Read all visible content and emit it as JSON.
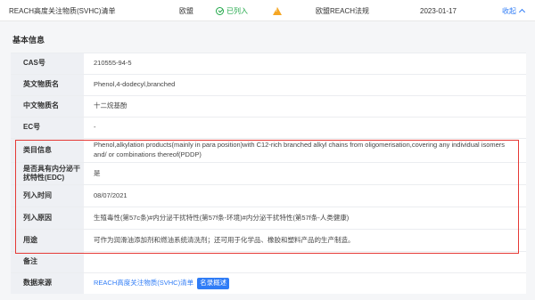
{
  "topbar": {
    "name": "REACH高度关注物质(SVHC)清单",
    "region": "欧盟",
    "status": "已列入",
    "law": "欧盟REACH法规",
    "date": "2023-01-17",
    "collapse_label": "收起"
  },
  "section_title": "基本信息",
  "rows": [
    {
      "label": "CAS号",
      "value": "210555-94-5"
    },
    {
      "label": "英文物质名",
      "value": "Phenol,4-dodecyl,branched"
    },
    {
      "label": "中文物质名",
      "value": "十二烷基酚"
    },
    {
      "label": "EC号",
      "value": "-"
    },
    {
      "label": "类目信息",
      "value": "Phenol,alkylation products(mainly in para position)with C12-rich branched alkyl chains from oligomerisation,covering any individual isomers and/ or combinations thereof(PDDP)"
    },
    {
      "label": "是否具有内分泌干扰特性(EDC)",
      "value": "是"
    },
    {
      "label": "列入时间",
      "value": "08/07/2021"
    },
    {
      "label": "列入原因",
      "value": "生殖毒性(第57c条)#内分泌干扰特性(第57f条-环境)#内分泌干扰特性(第57f条-人类健康)"
    },
    {
      "label": "用途",
      "value": "可作为润滑油添加剂和燃油系统清洗剂；还可用于化学品、橡胶和塑料产品的生产制造。"
    },
    {
      "label": "备注",
      "value": ""
    },
    {
      "label": "数据来源",
      "link": "REACH高度关注物质(SVHC)清单",
      "badge": "名录概述"
    }
  ],
  "colors": {
    "accent": "#2f7cf6",
    "success": "#22a84a",
    "warning": "#f5a623",
    "highlight": "#e53935"
  }
}
